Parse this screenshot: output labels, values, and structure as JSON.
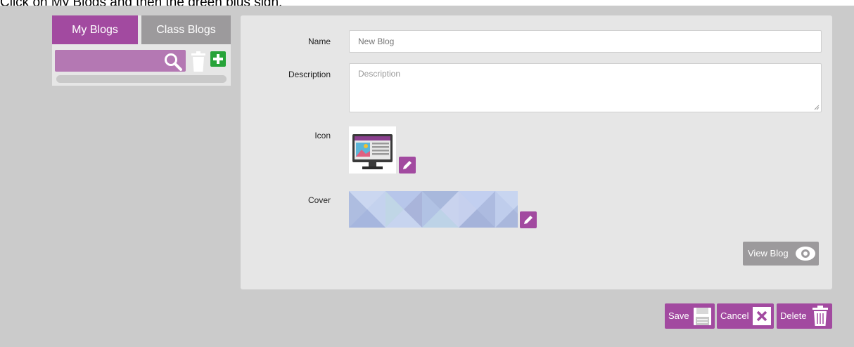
{
  "instruction": "Click on My Blogs and then the green plus sign.",
  "sidebar": {
    "tabs": [
      {
        "label": "My Blogs",
        "active": true
      },
      {
        "label": "Class Blogs",
        "active": false
      }
    ],
    "icons": [
      "search-icon",
      "trash-icon",
      "plus-icon"
    ]
  },
  "form": {
    "name_label": "Name",
    "name_placeholder": "New Blog",
    "description_label": "Description",
    "description_placeholder": "Description",
    "icon_label": "Icon",
    "cover_label": "Cover",
    "view_blog_label": "View Blog"
  },
  "actions": {
    "save_label": "Save",
    "cancel_label": "Cancel",
    "delete_label": "Delete"
  },
  "colors": {
    "accent": "#a24aa0",
    "tab_inactive": "#9c9a9c",
    "search_bg": "#b478b3",
    "add_green": "#27a339",
    "panel_bg": "#e6e6e6",
    "app_bg": "#cbcbcb"
  }
}
